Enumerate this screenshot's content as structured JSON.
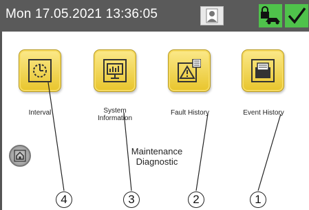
{
  "header": {
    "datetime": "Mon 17.05.2021  13:36:05"
  },
  "tiles": [
    {
      "label": "Interval",
      "icon": "clock-icon"
    },
    {
      "label": "System Information",
      "label_line1": "System",
      "label_line2": "Information",
      "icon": "chart-monitor-icon"
    },
    {
      "label": "Fault History",
      "icon": "warning-document-icon"
    },
    {
      "label": "Event History",
      "icon": "folder-icon"
    }
  ],
  "page_title": {
    "line1": "Maintenance",
    "line2": "Diagnostic"
  },
  "callouts": [
    "4",
    "3",
    "2",
    "1"
  ],
  "colors": {
    "header_bg": "#5a5a5a",
    "tile": "#f0d245",
    "status_green": "#4fc24b"
  }
}
